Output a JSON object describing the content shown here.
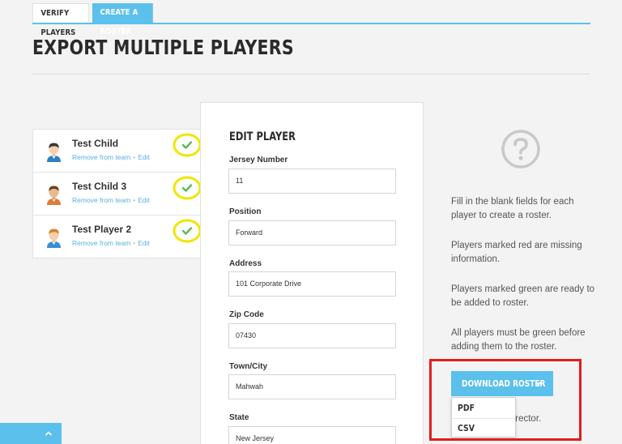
{
  "tabs": [
    {
      "label": "VERIFY PLAYERS",
      "active": false
    },
    {
      "label": "CREATE A ROSTER",
      "active": true
    }
  ],
  "page_title": "EXPORT MULTIPLE PLAYERS",
  "players": [
    {
      "name": "Test Child",
      "remove_label": "Remove from team",
      "sep": "•",
      "edit_label": "Edit",
      "status": "green",
      "icon": "check-icon"
    },
    {
      "name": "Test Child 3",
      "remove_label": "Remove from team",
      "sep": "•",
      "edit_label": "Edit",
      "status": "green",
      "icon": "check-icon"
    },
    {
      "name": "Test Player 2",
      "remove_label": "Remove from team",
      "sep": "•",
      "edit_label": "Edit",
      "status": "green",
      "icon": "check-icon"
    }
  ],
  "edit_panel": {
    "title": "EDIT PLAYER",
    "fields": [
      {
        "label": "Jersey Number",
        "value": "11"
      },
      {
        "label": "Position",
        "value": "Forward"
      },
      {
        "label": "Address",
        "value": "101 Corporate Drive"
      },
      {
        "label": "Zip Code",
        "value": "07430"
      },
      {
        "label": "Town/City",
        "value": "Mahwah"
      },
      {
        "label": "State",
        "value": "New Jersey"
      }
    ]
  },
  "help": {
    "icon": "question-circle-icon",
    "paragraphs": [
      "Fill in the blank fields for each player to create a roster.",
      "Players marked red are missing information.",
      "Players marked green are ready to be added to roster.",
      "All players must be green before adding them to the roster."
    ],
    "behind_dropdown_text": "Email to your director."
  },
  "download": {
    "button_label": "DOWNLOAD ROSTER",
    "options": [
      "PDF",
      "CSV"
    ]
  },
  "colors": {
    "accent": "#5bc0eb",
    "check_green": "#5cb85c",
    "highlight_yellow": "#f2e600",
    "annotation_red": "#e41c1c"
  }
}
